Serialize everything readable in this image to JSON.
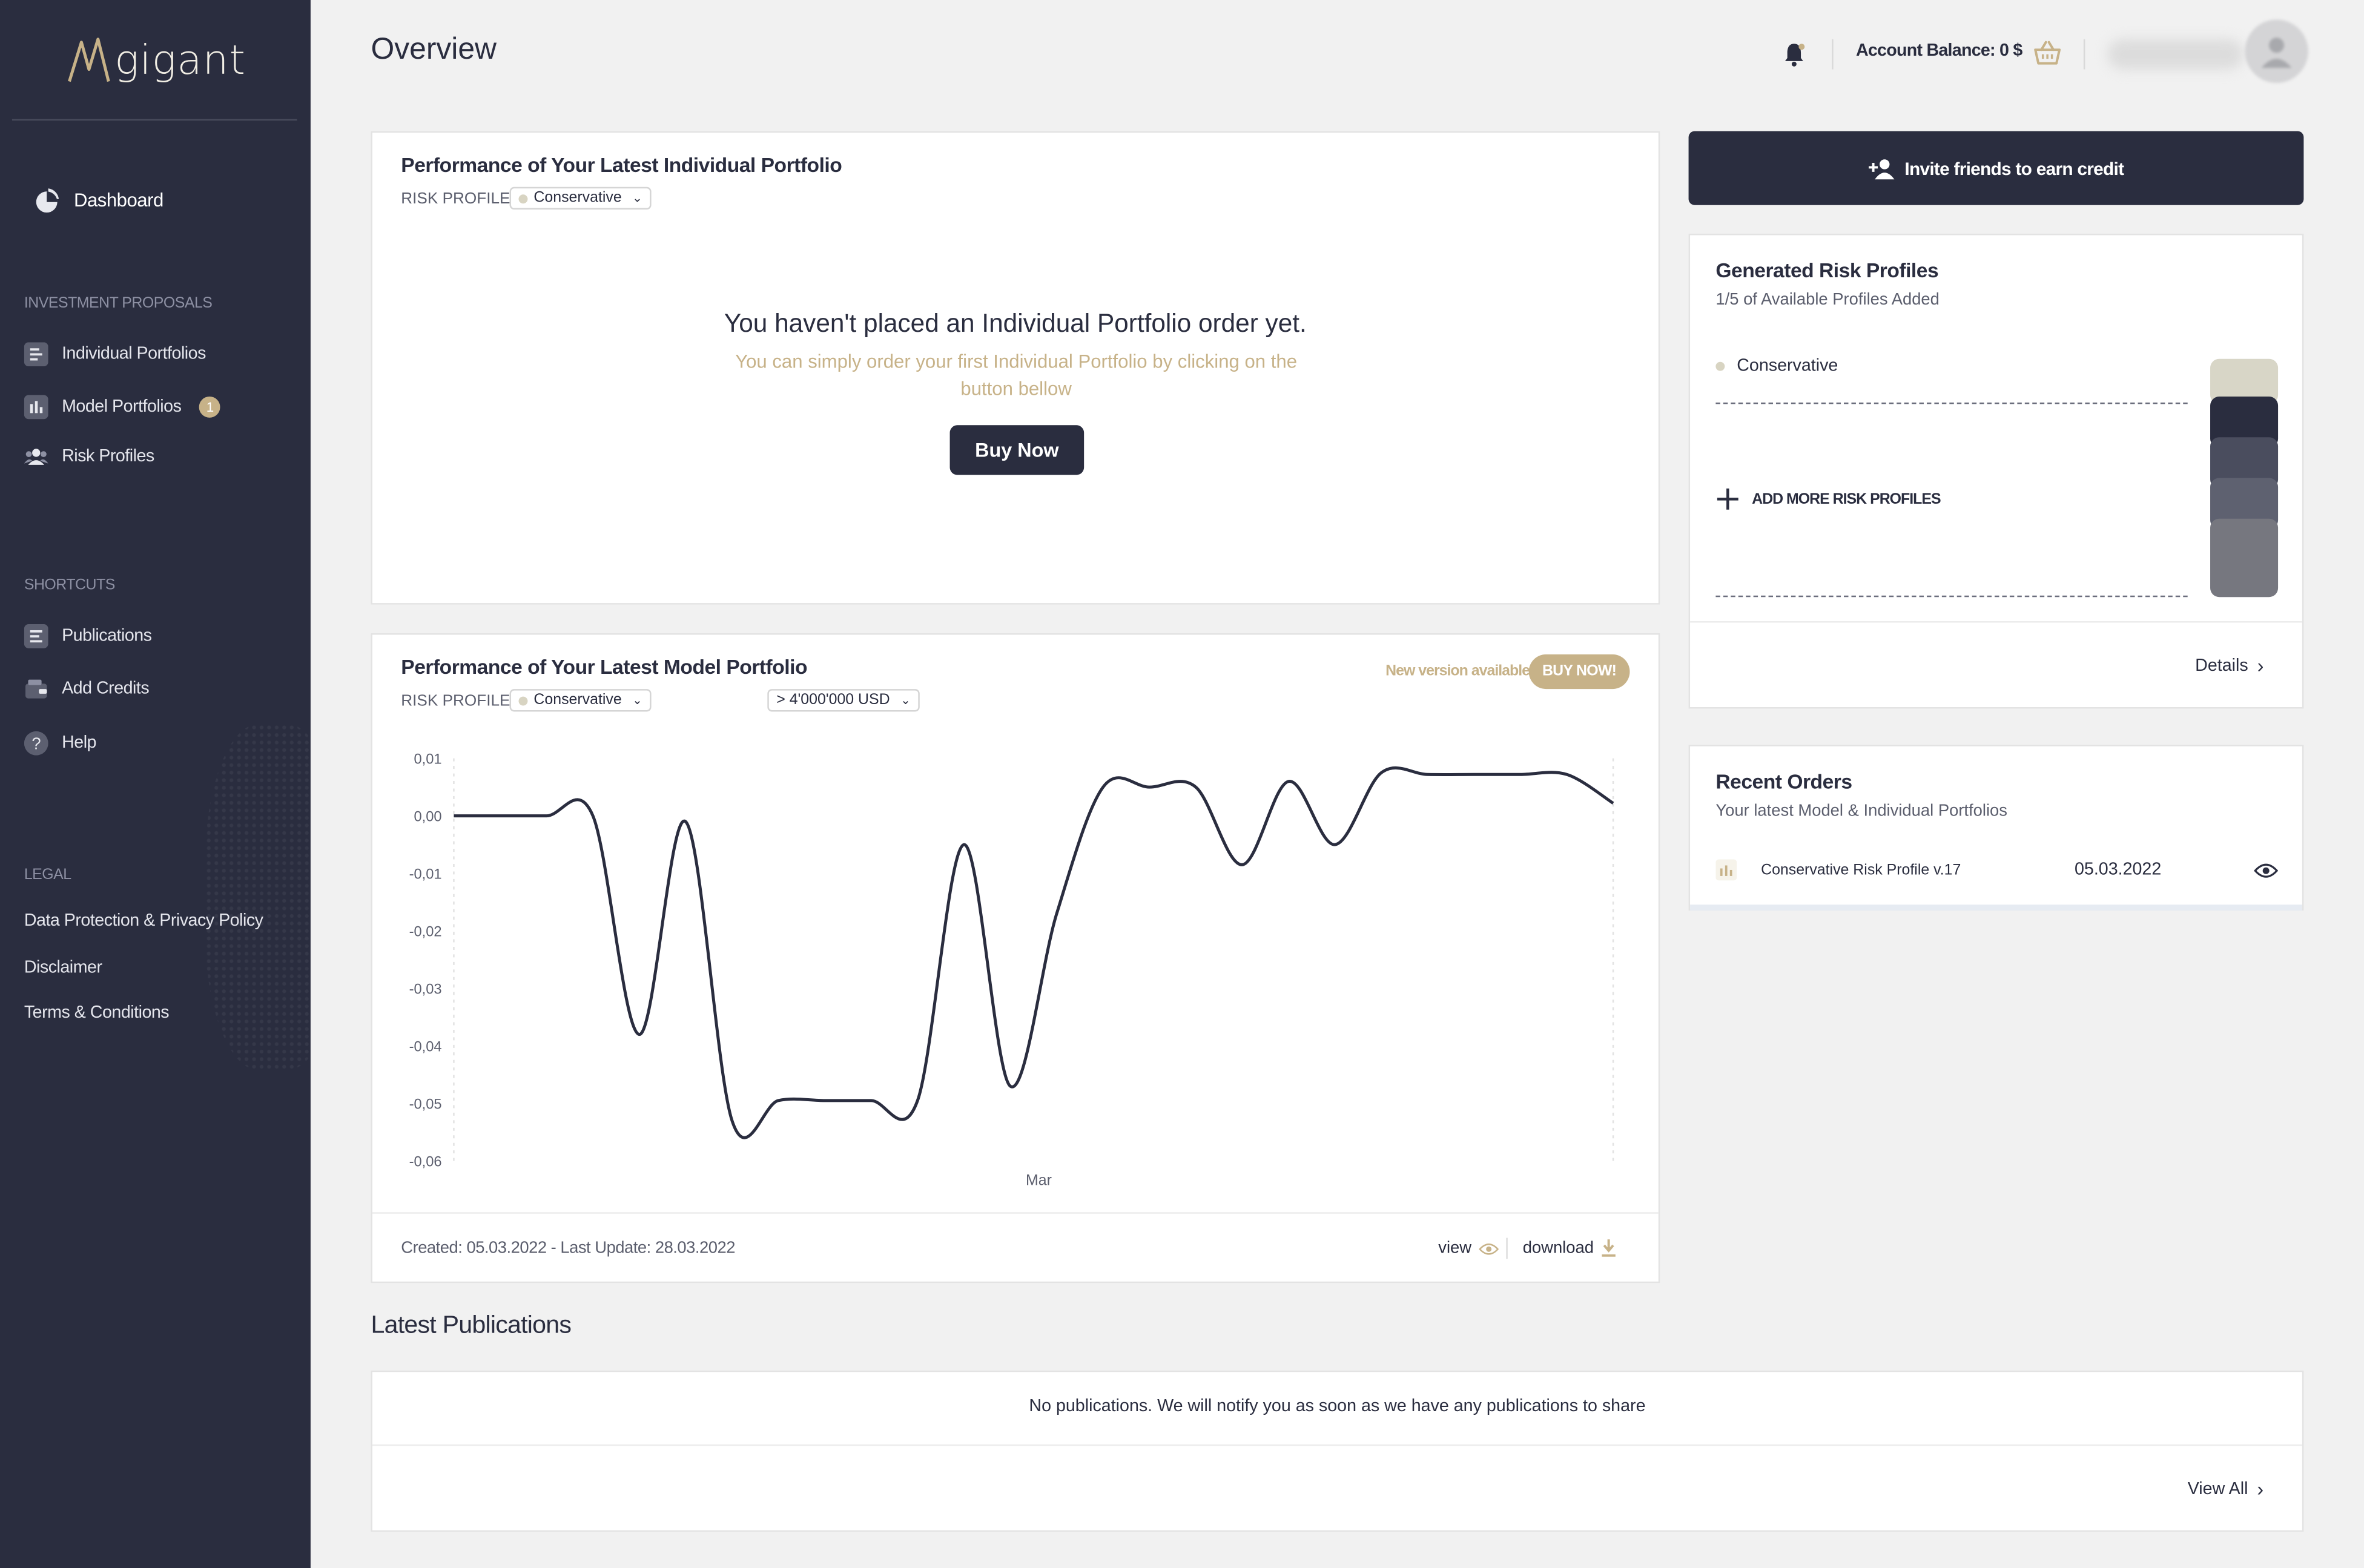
{
  "brand": {
    "name": "gigant"
  },
  "sidebar": {
    "dashboard": "Dashboard",
    "investment_title": "INVESTMENT PROPOSALS",
    "investment_items": [
      {
        "label": "Individual Portfolios",
        "icon": "list-icon"
      },
      {
        "label": "Model Portfolios",
        "icon": "bar-chart-icon",
        "badge": "1"
      },
      {
        "label": "Risk Profiles",
        "icon": "users-icon"
      }
    ],
    "shortcuts_title": "SHORTCUTS",
    "shortcut_items": [
      {
        "label": "Publications",
        "icon": "document-icon"
      },
      {
        "label": "Add Credits",
        "icon": "wallet-icon"
      },
      {
        "label": "Help",
        "icon": "help-icon"
      }
    ],
    "legal_title": "LEGAL",
    "legal_items": [
      "Data Protection & Privacy Policy",
      "Disclaimer",
      "Terms & Conditions"
    ]
  },
  "header": {
    "title": "Overview",
    "account_balance": "Account Balance: 0 $"
  },
  "individual_card": {
    "title": "Performance of Your Latest Individual Portfolio",
    "risk_label": "RISK PROFILE",
    "risk_value": "Conservative",
    "empty_title": "You haven't placed an Individual Portfolio order yet.",
    "empty_sub": "You can simply order your first Individual Portfolio by clicking on the button bellow",
    "buy_label": "Buy Now"
  },
  "model_card": {
    "title": "Performance of Your Latest Model Portfolio",
    "risk_label": "RISK PROFILE",
    "risk_value": "Conservative",
    "amount_value": "> 4'000'000 USD",
    "new_version": "New version available",
    "buy_now": "BUY NOW!",
    "created": "Created: 05.03.2022 - Last Update: 28.03.2022",
    "view": "view",
    "download": "download"
  },
  "chart_data": {
    "type": "line",
    "yticks": [
      "0,01",
      "0,00",
      "-0,01",
      "-0,02",
      "-0,03",
      "-0,04",
      "-0,05",
      "-0,06"
    ],
    "ylim": [
      -0.06,
      0.01
    ],
    "xticks": [
      "Mar"
    ],
    "series": [
      {
        "values": [
          0.0,
          0.0,
          0.0,
          0.0,
          -0.038,
          -0.001,
          -0.053,
          -0.0495,
          -0.0495,
          -0.0495,
          -0.0495,
          -0.005,
          -0.047,
          -0.017,
          0.005,
          0.005,
          0.005,
          -0.0085,
          0.006,
          -0.005,
          0.0075,
          0.0072,
          0.0072,
          0.0072,
          0.0072,
          0.0022
        ]
      }
    ],
    "color": "#2a2d3f",
    "grid": false
  },
  "risk_profiles_card": {
    "title": "Generated Risk Profiles",
    "subtitle": "1/5 of Available Profiles Added",
    "profile": "Conservative",
    "add_more": "ADD MORE RISK PROFILES",
    "details": "Details"
  },
  "invite": {
    "label": "Invite friends to earn credit"
  },
  "recent_orders": {
    "title": "Recent Orders",
    "subtitle": "Your latest Model & Individual Portfolios",
    "rows": [
      {
        "name": "Conservative Risk Profile v.17",
        "date": "05.03.2022"
      }
    ]
  },
  "publications": {
    "title": "Latest Publications",
    "empty": "No publications. We will notify you as soon as we have any publications to share",
    "view_all": "View All"
  },
  "colors": {
    "dark": "#2a2d3f",
    "gold": "#c7b288",
    "background": "#f1f1f1"
  }
}
